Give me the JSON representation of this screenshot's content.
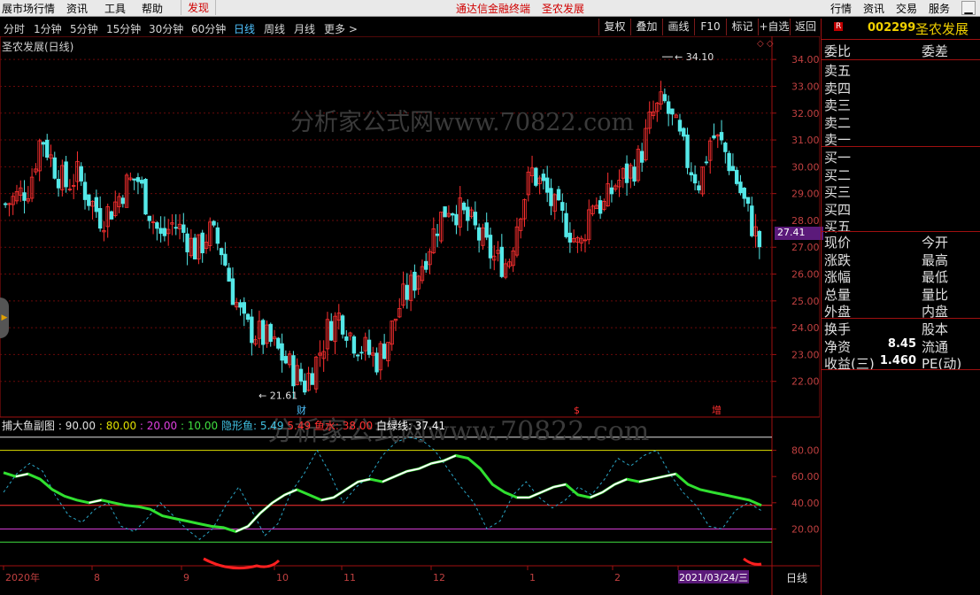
{
  "menubar": {
    "left_items": [
      "展市场行情",
      "资讯",
      "工具",
      "帮助",
      "发现"
    ],
    "center_items": [
      "通达信金融终端",
      "圣农发展"
    ],
    "right_items": [
      "行情",
      "资讯",
      "交易",
      "服务"
    ]
  },
  "toolbar": {
    "periods": [
      "分时",
      "1分钟",
      "5分钟",
      "15分钟",
      "30分钟",
      "60分钟",
      "日线",
      "周线",
      "月线",
      "更多 >"
    ],
    "active_period": "日线",
    "tools": [
      "复权",
      "叠加",
      "画线",
      "F10",
      "标记",
      "+自选",
      "返回"
    ]
  },
  "chart_title": "圣农发展(日线)",
  "watermark": "分析家公式网www.70822.com",
  "indicator_header": {
    "name": "捕大鱼副图",
    "items": [
      {
        "label": ": 90.00",
        "color": "#e0e0e0"
      },
      {
        "label": ": 80.00",
        "color": "#e0e000"
      },
      {
        "label": ": 20.00",
        "color": "#e040e0"
      },
      {
        "label": ": 10.00",
        "color": "#40e040"
      },
      {
        "label": "隐形鱼: 5.49",
        "color": "#40c0e0"
      },
      {
        "label": "5.49",
        "color": "#ff3030"
      },
      {
        "label": "鱼水: 38.00",
        "color": "#ff3030"
      },
      {
        "label": "白绿线: 37.41",
        "color": "#ffffff"
      }
    ]
  },
  "annotations": {
    "high": "34.10",
    "low": "21.61",
    "event1": "财",
    "event2": "$",
    "event3": "增"
  },
  "current_price_tag": "27.41",
  "x_axis": {
    "labels": [
      "2020年",
      "8",
      "9",
      "10",
      "11",
      "12",
      "1",
      "2",
      "3"
    ],
    "date_tag": "2021/03/24/三",
    "period_tag": "日线"
  },
  "stock_header": {
    "badge": "R",
    "code": "002299",
    "name": "圣农发展"
  },
  "right_panel": {
    "top": {
      "left": "委比",
      "right": "委差"
    },
    "asks": [
      "卖五",
      "卖四",
      "卖三",
      "卖二",
      "卖一"
    ],
    "bids": [
      "买一",
      "买二",
      "买三",
      "买四",
      "买五"
    ],
    "stats": [
      {
        "left": "现价",
        "value": "",
        "right": "今开"
      },
      {
        "left": "涨跌",
        "value": "",
        "right": "最高"
      },
      {
        "left": "涨幅",
        "value": "",
        "right": "最低"
      },
      {
        "left": "总量",
        "value": "",
        "right": "量比"
      },
      {
        "left": "外盘",
        "value": "",
        "right": "内盘"
      }
    ],
    "stats2": [
      {
        "left": "换手",
        "value": "",
        "right": "股本"
      },
      {
        "left": "净资",
        "value": "8.45",
        "right": "流通"
      },
      {
        "left": "收益(三)",
        "value": "1.460",
        "right": "PE(动)"
      }
    ]
  },
  "chart_data": [
    {
      "type": "candlestick",
      "title": "圣农发展(日线)",
      "y_ticks": [
        34.0,
        33.0,
        32.0,
        31.0,
        30.0,
        29.0,
        28.0,
        27.0,
        26.0,
        25.0,
        24.0,
        23.0,
        22.0
      ],
      "ylim": [
        21.0,
        34.6
      ],
      "grid": true,
      "x_labels": [
        "2020年",
        "8",
        "9",
        "10",
        "11",
        "12",
        "1",
        "2",
        "3"
      ],
      "close_path": [
        28.6,
        28.9,
        29.3,
        31.2,
        30.1,
        29.3,
        29.7,
        28.8,
        28.1,
        28.5,
        29.3,
        29.6,
        28.4,
        27.3,
        27.9,
        27.5,
        26.8,
        27.6,
        27.0,
        25.3,
        24.0,
        23.8,
        23.5,
        23.0,
        22.4,
        21.9,
        22.8,
        24.0,
        24.5,
        23.6,
        23.2,
        22.8,
        23.6,
        24.9,
        25.6,
        26.6,
        27.8,
        28.6,
        28.3,
        27.8,
        27.1,
        26.5,
        26.4,
        28.5,
        29.8,
        29.2,
        28.3,
        27.8,
        26.9,
        28.8,
        28.5,
        29.4,
        29.7,
        30.3,
        31.9,
        32.4,
        31.4,
        30.2,
        29.4,
        31.2,
        30.7,
        29.6,
        28.3,
        27.1
      ],
      "annotations": [
        "34.10",
        "21.61"
      ],
      "last_price": "27.41"
    },
    {
      "type": "line",
      "title": "捕大鱼副图",
      "y_ticks": [
        80.0,
        60.0,
        40.0,
        20.0
      ],
      "ylim": [
        0,
        100
      ],
      "reference_lines": [
        {
          "value": 90,
          "color": "#e0e0e0"
        },
        {
          "value": 80,
          "color": "#e0e000"
        },
        {
          "value": 38,
          "color": "#ff3030"
        },
        {
          "value": 20,
          "color": "#e040e0"
        },
        {
          "value": 10,
          "color": "#40e040"
        }
      ],
      "series": [
        {
          "name": "白绿线",
          "values": [
            63,
            60,
            62,
            58,
            50,
            45,
            42,
            40,
            42,
            40,
            38,
            37,
            35,
            30,
            28,
            26,
            24,
            22,
            21,
            18,
            22,
            32,
            40,
            46,
            50,
            46,
            42,
            44,
            50,
            56,
            58,
            56,
            60,
            64,
            66,
            70,
            72,
            76,
            74,
            66,
            54,
            48,
            44,
            44,
            48,
            52,
            54,
            46,
            44,
            48,
            54,
            58,
            56,
            58,
            60,
            62,
            54,
            50,
            48,
            46,
            44,
            42,
            38
          ]
        },
        {
          "name": "隐形鱼",
          "values": [
            48,
            62,
            70,
            64,
            45,
            30,
            25,
            35,
            40,
            22,
            18,
            28,
            40,
            30,
            20,
            12,
            20,
            38,
            52,
            34,
            15,
            24,
            48,
            62,
            80,
            62,
            40,
            52,
            60,
            76,
            86,
            90,
            88,
            80,
            66,
            52,
            40,
            20,
            26,
            46,
            56,
            44,
            36,
            42,
            52,
            46,
            58,
            74,
            68,
            76,
            80,
            62,
            48,
            38,
            22,
            20,
            34,
            40,
            34
          ]
        }
      ]
    }
  ]
}
